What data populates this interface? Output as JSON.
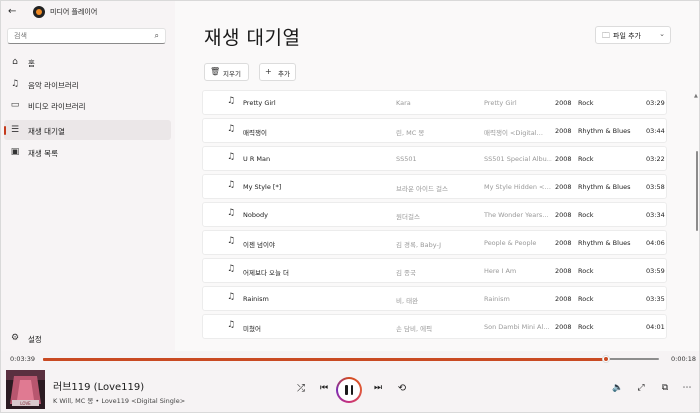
{
  "window": {
    "title": "미디어 플레이어"
  },
  "sidebar": {
    "search_placeholder": "검색",
    "items": [
      {
        "label": "홈",
        "icon": "home-icon"
      },
      {
        "label": "음악 라이브러리",
        "icon": "music-note-icon"
      },
      {
        "label": "비디오 라이브러리",
        "icon": "video-icon"
      },
      {
        "label": "재생 대기열",
        "icon": "queue-icon"
      },
      {
        "label": "재생 목록",
        "icon": "playlist-icon"
      }
    ],
    "settings_label": "설정"
  },
  "main": {
    "title": "재생 대기열",
    "add_file_label": "파일 추가",
    "clear_label": "지우기",
    "add_label": "추가",
    "columns_note": "title, artist, album, year, genre, duration",
    "tracks": [
      {
        "title": "Pretty Girl",
        "artist": "Kara",
        "album": "Pretty Girl",
        "year": "2008",
        "genre": "Rock",
        "duration": "03:29"
      },
      {
        "title": "매력쟁이",
        "artist": "린, MC 몽",
        "album": "매력쟁이 <Digital…",
        "year": "2008",
        "genre": "Rhythm & Blues",
        "duration": "03:44"
      },
      {
        "title": "U R Man",
        "artist": "SS501",
        "album": "SS501 Special Albu…",
        "year": "2008",
        "genre": "Rock",
        "duration": "03:22"
      },
      {
        "title": "My Style [*]",
        "artist": "브라운 아이드 걸스",
        "album": "My Style Hidden <…",
        "year": "2008",
        "genre": "Rhythm & Blues",
        "duration": "03:58"
      },
      {
        "title": "Nobody",
        "artist": "원더걸스",
        "album": "The Wonder Years…",
        "year": "2008",
        "genre": "Rock",
        "duration": "03:34"
      },
      {
        "title": "이젠 넘이야",
        "artist": "김 경록, Baby-J",
        "album": "People & People",
        "year": "2008",
        "genre": "Rhythm & Blues",
        "duration": "04:06"
      },
      {
        "title": "어제보다 오늘 더",
        "artist": "김 종국",
        "album": "Here I Am",
        "year": "2008",
        "genre": "Rock",
        "duration": "03:59"
      },
      {
        "title": "Rainism",
        "artist": "비, 태완",
        "album": "Rainism",
        "year": "2008",
        "genre": "Rock",
        "duration": "03:35"
      },
      {
        "title": "미쳤어",
        "artist": "손 담비, 에픽",
        "album": "Son Dambi Mini Al…",
        "year": "2008",
        "genre": "Rock",
        "duration": "04:01"
      }
    ]
  },
  "player": {
    "elapsed": "0:03:39",
    "remaining": "0:00:18",
    "progress_fraction": 0.914,
    "now_title": "러브119 (Love119)",
    "now_subtitle": "K Will, MC 몽 • Love119 <Digital Single>",
    "accent_color": "#c94a22"
  }
}
